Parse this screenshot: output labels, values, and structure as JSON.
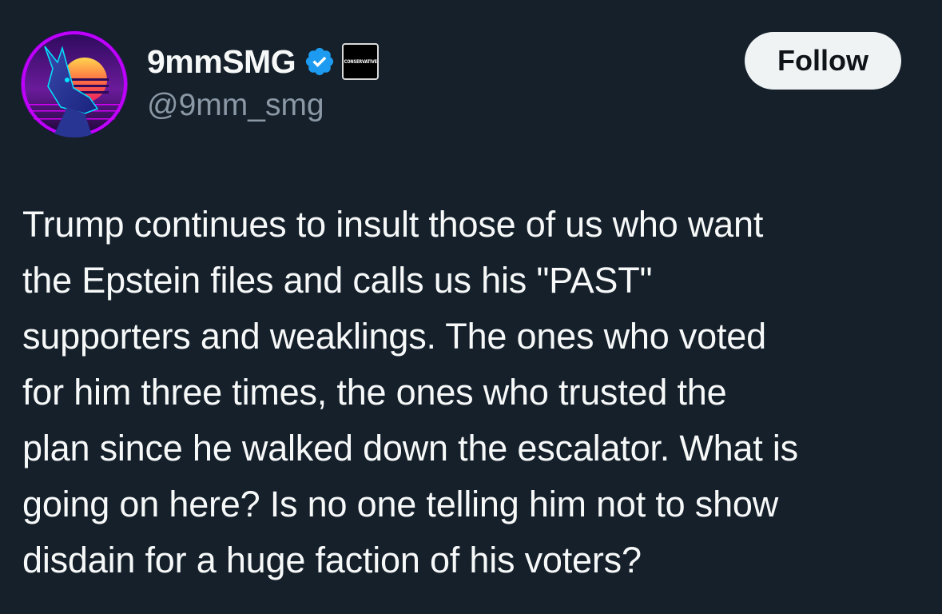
{
  "author": {
    "display_name": "9mmSMG",
    "handle": "@9mm_smg",
    "avatar_icon": "doberman-synthwave-avatar",
    "verified_icon": "verified-badge-icon",
    "verified_color": "#1d9bf0",
    "affiliation_badge_text": "CONSERVATIVE"
  },
  "actions": {
    "follow_label": "Follow"
  },
  "tweet": {
    "text": "Trump continues to insult those of us who want\nthe Epstein files and calls us his \"PAST\"\nsupporters and weaklings. The ones who voted\nfor him three times, the ones who trusted the\nplan since he walked down the escalator. What is\ngoing on here? Is no one telling him not to show\ndisdain for a huge faction of his voters?"
  },
  "colors": {
    "background": "#15202b",
    "text_primary": "#f7f9f9",
    "text_secondary": "#8b98a5",
    "button_bg": "#eff3f4",
    "button_text": "#0f1419"
  }
}
